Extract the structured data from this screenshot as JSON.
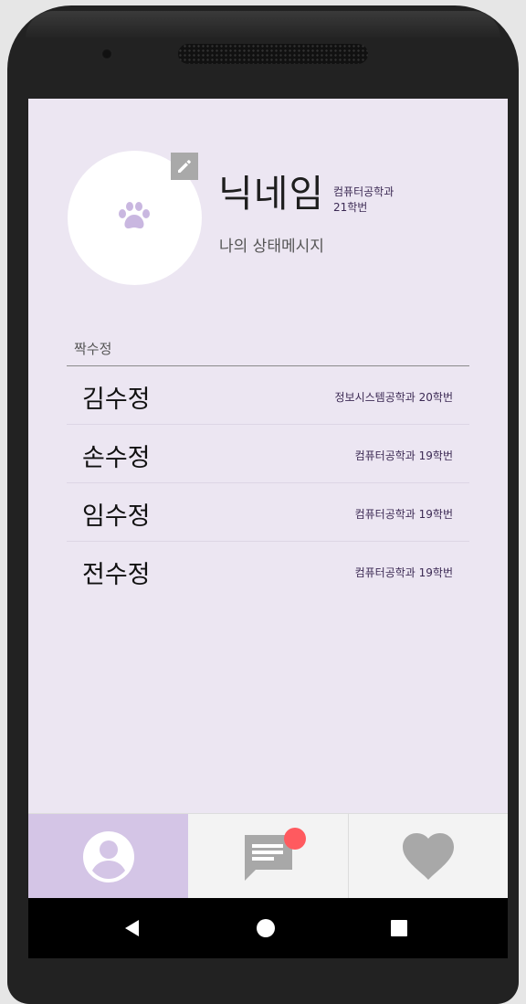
{
  "profile": {
    "nickname": "닉네임",
    "department": "컴퓨터공학과",
    "student_id": "21학번",
    "status_message": "나의 상태메시지",
    "avatar_icon": "paw-icon",
    "edit_icon": "pencil-icon"
  },
  "section": {
    "title": "짝수정"
  },
  "list": [
    {
      "name": "김수정",
      "info": "정보시스템공학과 20학번"
    },
    {
      "name": "손수정",
      "info": "컴퓨터공학과 19학번"
    },
    {
      "name": "임수정",
      "info": "컴퓨터공학과 19학번"
    },
    {
      "name": "전수정",
      "info": "컴퓨터공학과 19학번"
    }
  ],
  "tabs": [
    {
      "icon": "profile-icon",
      "selected": true
    },
    {
      "icon": "chat-icon",
      "has_badge": true
    },
    {
      "icon": "heart-icon"
    }
  ],
  "system_nav": [
    "back-icon",
    "home-icon",
    "recents-icon"
  ],
  "colors": {
    "screen_bg": "#ece6f2",
    "accent": "#d4c5e6",
    "paw": "#c9b7e0",
    "badge": "#ff5a5f",
    "icon_gray": "#a8a8a8"
  }
}
